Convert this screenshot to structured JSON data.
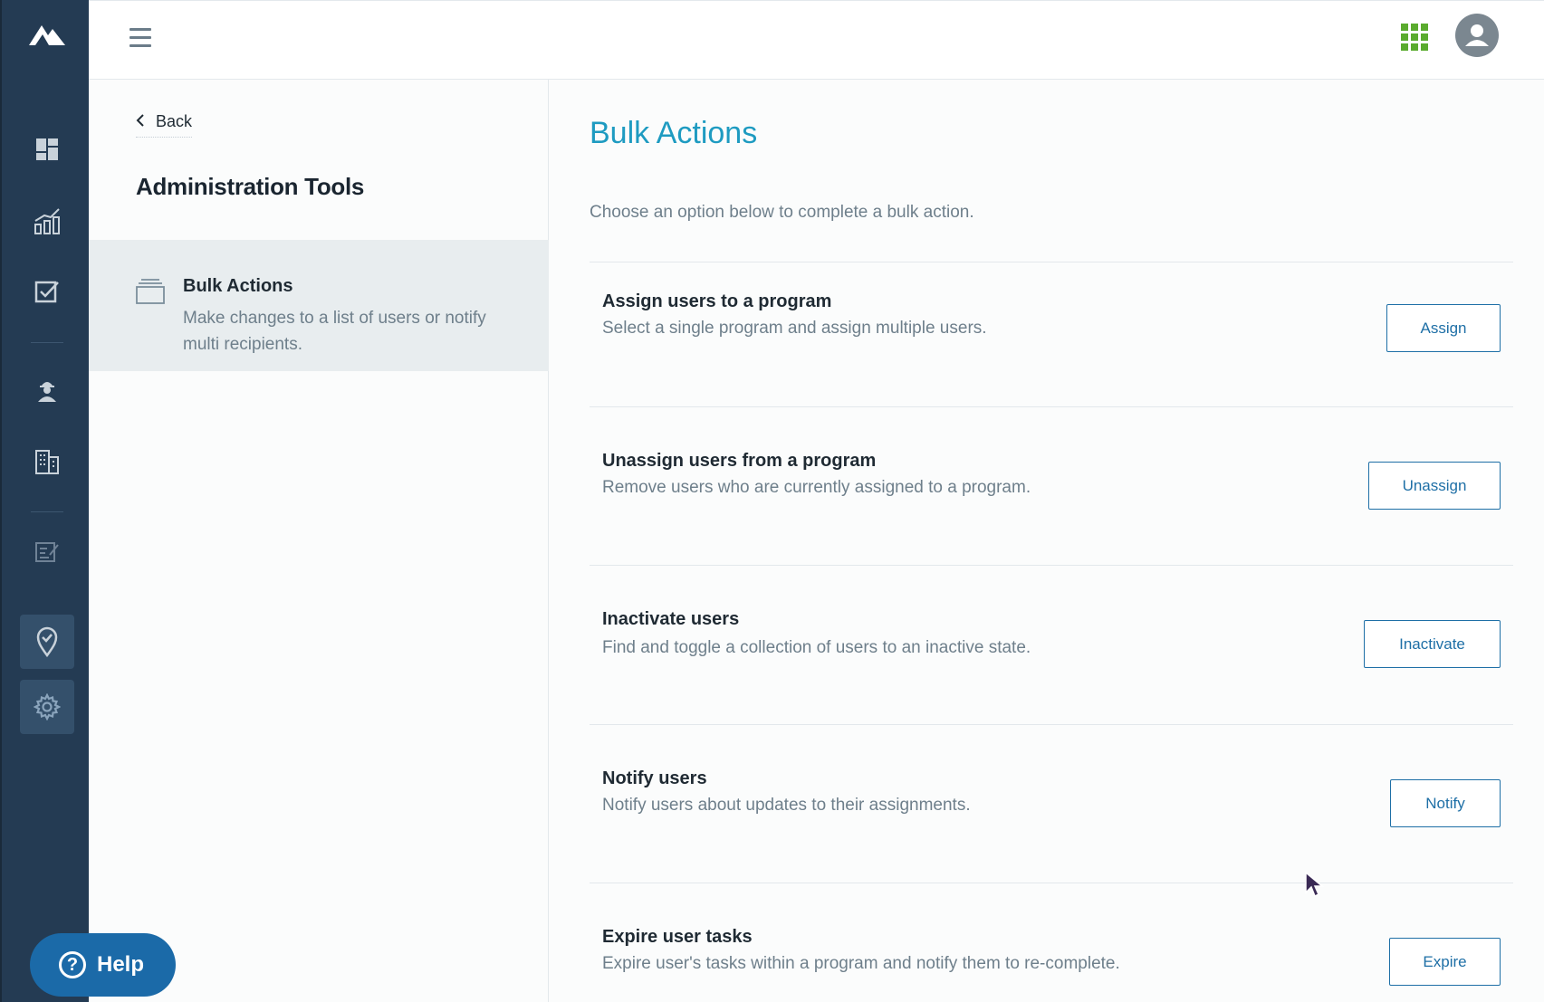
{
  "topbar": {
    "menu_icon": "hamburger-menu-icon",
    "apps_icon": "apps-grid-icon",
    "apps_color": "#5aab2e",
    "avatar_icon": "user-avatar-icon"
  },
  "rail": {
    "logo_icon": "mountain-logo-icon",
    "items": [
      {
        "icon": "dashboard-icon"
      },
      {
        "icon": "analytics-chart-icon"
      },
      {
        "icon": "checkbox-task-icon"
      },
      {
        "icon": "worker-person-icon"
      },
      {
        "icon": "building-icon"
      },
      {
        "icon": "edit-form-icon"
      },
      {
        "icon": "location-pin-icon",
        "active": true
      },
      {
        "icon": "settings-gear-icon",
        "active": true
      }
    ]
  },
  "panel": {
    "back_label": "Back",
    "title": "Administration Tools",
    "item": {
      "icon": "stack-layers-icon",
      "title": "Bulk Actions",
      "description": "Make changes to a list of users or notify multi recipients."
    }
  },
  "main": {
    "title": "Bulk Actions",
    "subtitle": "Choose an option below to complete a bulk action.",
    "title_color": "#1e9bc1",
    "actions": [
      {
        "title": "Assign users to a program",
        "description": "Select a single program and assign multiple users.",
        "button": "Assign"
      },
      {
        "title": "Unassign users from a program",
        "description": "Remove users who are currently assigned to a program.",
        "button": "Unassign"
      },
      {
        "title": "Inactivate users",
        "description": "Find and toggle a collection of users to an inactive state.",
        "button": "Inactivate"
      },
      {
        "title": "Notify users",
        "description": "Notify users about updates to their assignments.",
        "button": "Notify"
      },
      {
        "title": "Expire user tasks",
        "description": "Expire user's tasks within a program and notify them to re-complete.",
        "button": "Expire"
      }
    ]
  },
  "help": {
    "label": "Help",
    "color": "#1b6aa8"
  }
}
